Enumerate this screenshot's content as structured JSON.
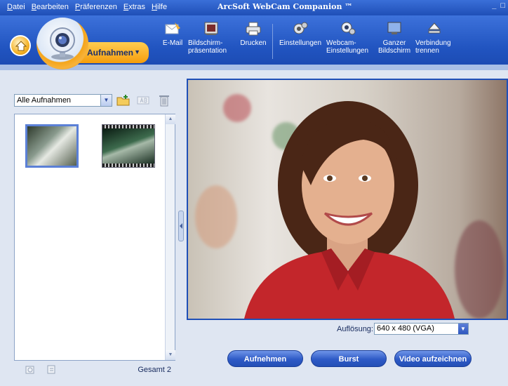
{
  "menu": {
    "items": [
      "Datei",
      "Bearbeiten",
      "Präferenzen",
      "Extras",
      "Hilfe"
    ]
  },
  "window": {
    "title": "ArcSoft WebCam Companion ™",
    "minimize": "_",
    "restore": "□"
  },
  "toolbar": {
    "mode_label": "Aufnahmen",
    "mode_arrow": "▼",
    "buttons": [
      {
        "label": "E-Mail",
        "icon": "email-icon"
      },
      {
        "label": "Bildschirm-\npräsentation",
        "icon": "slideshow-icon"
      },
      {
        "label": "Drucken",
        "icon": "printer-icon"
      },
      {
        "label": "Einstellungen",
        "icon": "settings-icon"
      },
      {
        "label": "Webcam-\nEinstellungen",
        "icon": "webcam-settings-icon"
      },
      {
        "label": "Ganzer\nBildschirm",
        "icon": "fullscreen-icon"
      },
      {
        "label": "Verbindung\ntrennen",
        "icon": "eject-icon"
      }
    ]
  },
  "left_panel": {
    "filter_value": "Alle Aufnahmen",
    "filter_arrow": "▼",
    "total_label": "Gesamt 2",
    "thumbnails": [
      {
        "kind": "photo"
      },
      {
        "kind": "video"
      }
    ]
  },
  "preview": {
    "resolution_label": "Auflösung:",
    "resolution_value": "640 x 480 (VGA)"
  },
  "actions": {
    "capture": "Aufnehmen",
    "burst": "Burst",
    "record": "Video aufzeichnen"
  },
  "colors": {
    "toolbar_blue": "#2154c0",
    "accent_orange": "#f59d0d",
    "panel_bg": "#dfe6f2"
  }
}
